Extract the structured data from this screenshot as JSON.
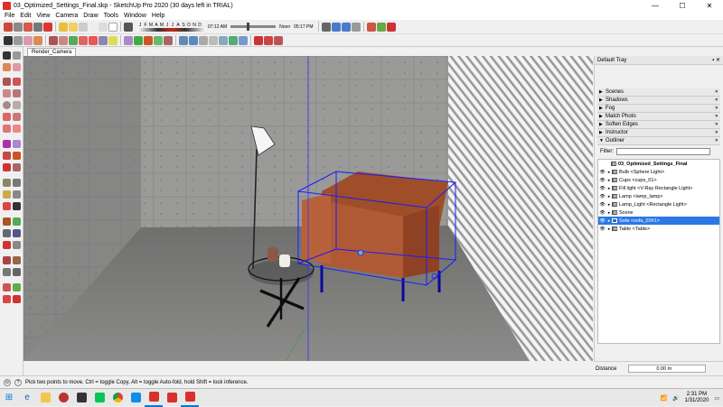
{
  "window": {
    "title": "03_Optimized_Settings_Final.skp - SketchUp Pro 2020 (30 days left in TRIAL)",
    "minimize": "—",
    "maximize": "☐",
    "close": "✕"
  },
  "menu": [
    "File",
    "Edit",
    "View",
    "Camera",
    "Draw",
    "Tools",
    "Window",
    "Help"
  ],
  "shadow": {
    "months": [
      "J",
      "F",
      "M",
      "A",
      "M",
      "J",
      "J",
      "A",
      "S",
      "O",
      "N",
      "D"
    ],
    "time_start": "07:12 AM",
    "time_mid": "Noon",
    "time_end": "05:17 PM"
  },
  "tab": {
    "label": "Render_Camera"
  },
  "tray": {
    "title": "Default Tray",
    "panels": [
      {
        "label": "Scenes",
        "state": "collapsed"
      },
      {
        "label": "Shadows",
        "state": "collapsed"
      },
      {
        "label": "Fog",
        "state": "collapsed"
      },
      {
        "label": "Match Photo",
        "state": "collapsed"
      },
      {
        "label": "Soften Edges",
        "state": "collapsed"
      },
      {
        "label": "Instructor",
        "state": "collapsed"
      },
      {
        "label": "Outliner",
        "state": "expanded"
      }
    ],
    "filter_label": "Filter:",
    "outliner_root": "03_Optimized_Settings_Final",
    "outliner_items": [
      {
        "label": "Bulb <Sphere Light>",
        "selected": false
      },
      {
        "label": "Cups <cups_01>",
        "selected": false
      },
      {
        "label": "Fill light <V-Ray Rectangle Light>",
        "selected": false
      },
      {
        "label": "Lamp <lamp_lamp>",
        "selected": false
      },
      {
        "label": "Lamp_Light <Rectangle Light>",
        "selected": false
      },
      {
        "label": "Scene",
        "selected": false
      },
      {
        "label": "Sofa <sofa_02#1>",
        "selected": true
      },
      {
        "label": "Table <Table>",
        "selected": false
      }
    ]
  },
  "distance": {
    "label": "Distance",
    "value": "0.00 m"
  },
  "status": {
    "text": "Pick two points to move.  Ctrl = toggle Copy, Alt = toggle Auto-fold, hold Shift = lock inference."
  },
  "clock": {
    "time": "2:31 PM",
    "date": "1/31/2020"
  },
  "taskbar": {
    "apps": [
      "windows-start",
      "edge",
      "file-explorer",
      "photos",
      "calculator",
      "line",
      "chrome",
      "teamviewer",
      "sketchup",
      "sketchup-2",
      "sketchup-3"
    ]
  },
  "colors": {
    "selection": "#1a1aff",
    "tray_selected": "#2b78e4"
  }
}
